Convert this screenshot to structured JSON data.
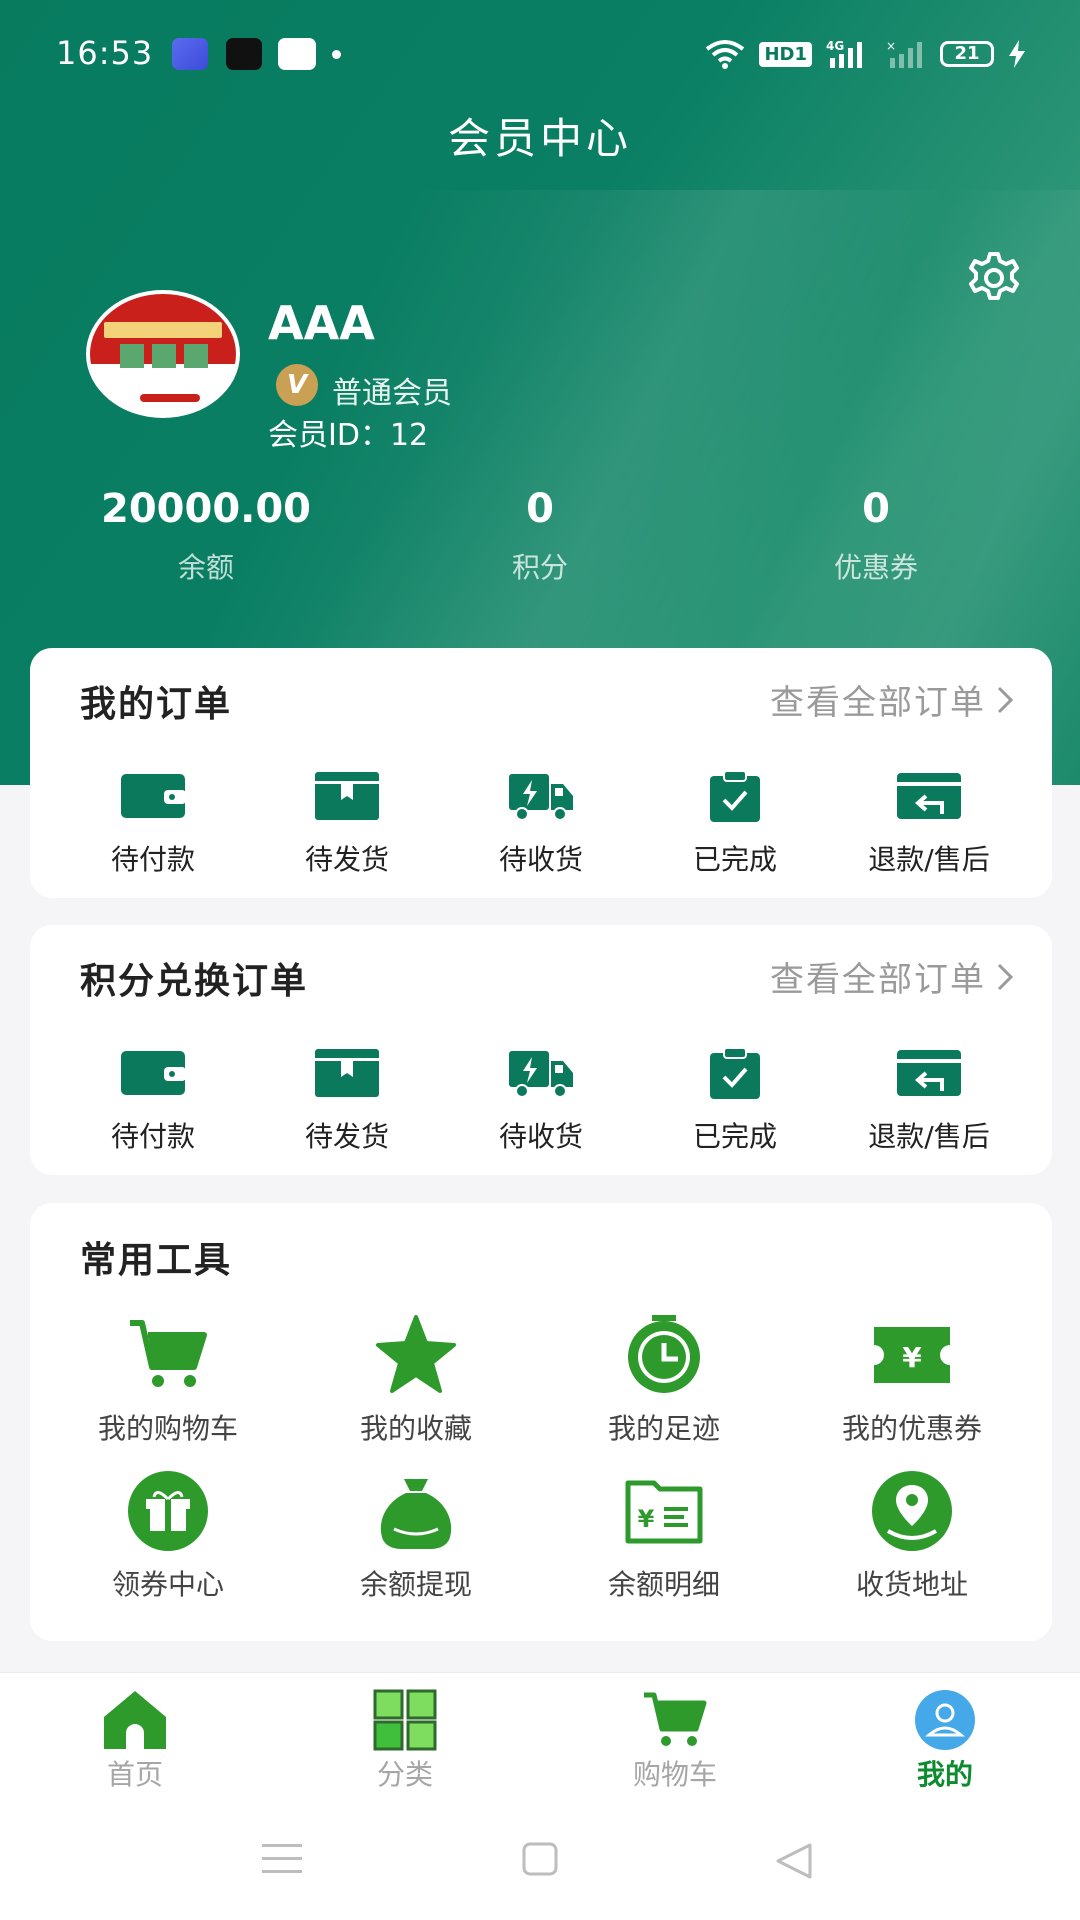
{
  "status_bar": {
    "time": "16:53",
    "battery": "21",
    "network": "4G",
    "hd": "HD1"
  },
  "header": {
    "title": "会员中心"
  },
  "profile": {
    "name": "AAA",
    "vip_badge": "V",
    "level": "普通会员",
    "member_id": "会员ID：12"
  },
  "stats": [
    {
      "value": "20000.00",
      "label": "余额"
    },
    {
      "value": "0",
      "label": "积分"
    },
    {
      "value": "0",
      "label": "优惠券"
    }
  ],
  "orders": {
    "title": "我的订单",
    "view_all": "查看全部订单",
    "items": [
      {
        "label": "待付款",
        "icon": "wallet-icon"
      },
      {
        "label": "待发货",
        "icon": "box-icon"
      },
      {
        "label": "待收货",
        "icon": "truck-icon"
      },
      {
        "label": "已完成",
        "icon": "clipboard-check-icon"
      },
      {
        "label": "退款/售后",
        "icon": "refund-icon"
      }
    ]
  },
  "points_orders": {
    "title": "积分兑换订单",
    "view_all": "查看全部订单",
    "items": [
      {
        "label": "待付款",
        "icon": "wallet-icon"
      },
      {
        "label": "待发货",
        "icon": "box-icon"
      },
      {
        "label": "待收货",
        "icon": "truck-icon"
      },
      {
        "label": "已完成",
        "icon": "clipboard-check-icon"
      },
      {
        "label": "退款/售后",
        "icon": "refund-icon"
      }
    ]
  },
  "tools": {
    "title": "常用工具",
    "items": [
      {
        "label": "我的购物车",
        "icon": "cart-icon"
      },
      {
        "label": "我的收藏",
        "icon": "star-icon"
      },
      {
        "label": "我的足迹",
        "icon": "clock-icon"
      },
      {
        "label": "我的优惠券",
        "icon": "coupon-icon"
      },
      {
        "label": "领券中心",
        "icon": "gift-icon"
      },
      {
        "label": "余额提现",
        "icon": "money-bag-icon"
      },
      {
        "label": "余额明细",
        "icon": "bill-icon"
      },
      {
        "label": "收货地址",
        "icon": "location-icon"
      }
    ]
  },
  "bottom_nav": [
    {
      "label": "首页",
      "icon": "home-icon",
      "active": false
    },
    {
      "label": "分类",
      "icon": "category-icon",
      "active": false
    },
    {
      "label": "购物车",
      "icon": "cart-icon",
      "active": false
    },
    {
      "label": "我的",
      "icon": "profile-icon",
      "active": true
    }
  ],
  "colors": {
    "brand_green": "#087b5f",
    "icon_green": "#0b7a5c",
    "tool_green": "#2e9a2b",
    "nav_active": "#0e8a2f"
  }
}
